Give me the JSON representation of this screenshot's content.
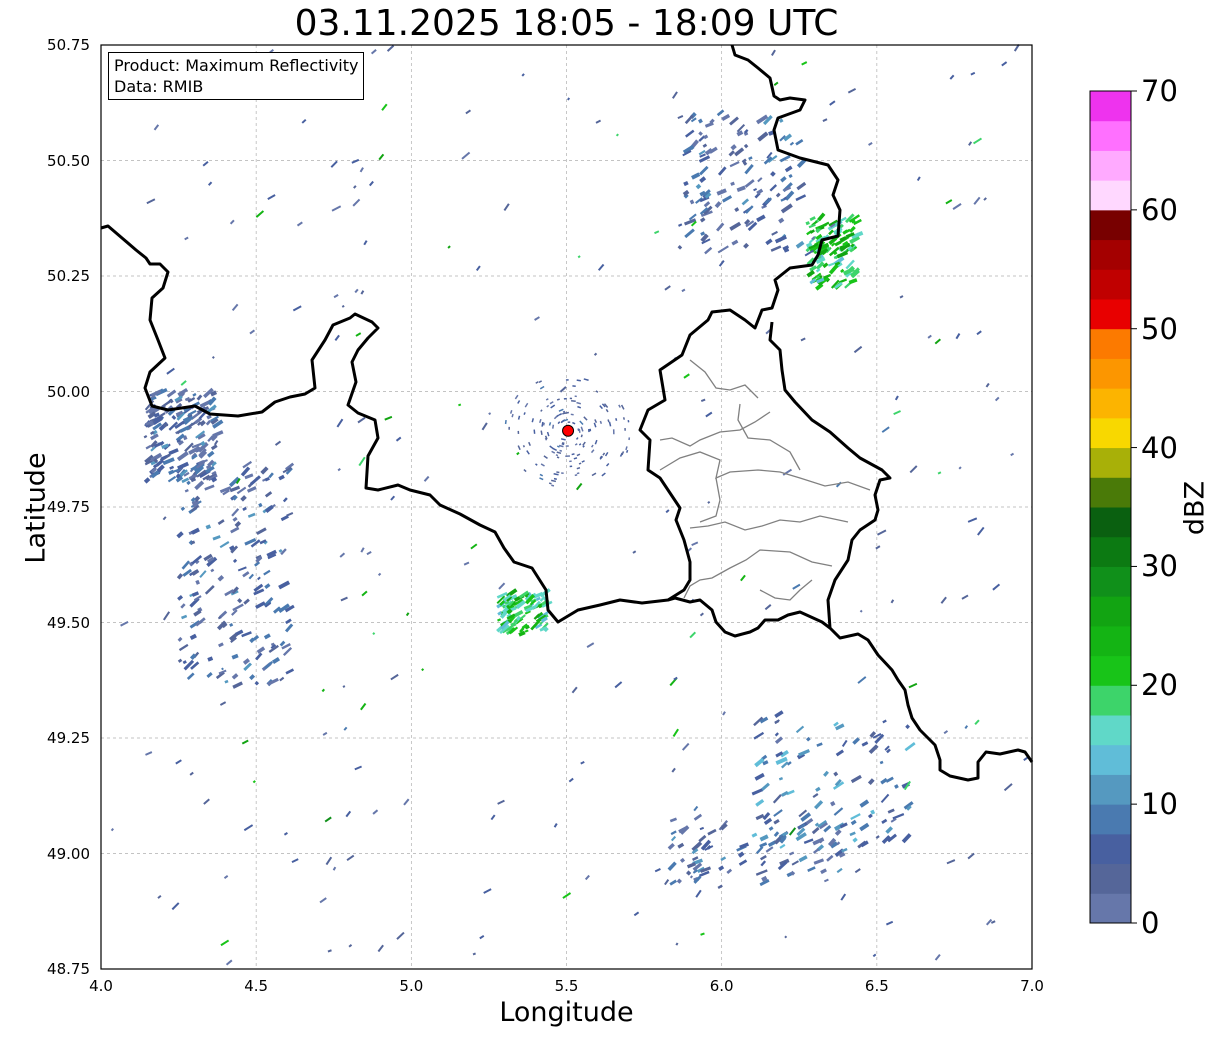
{
  "title": "03.11.2025 18:05 - 18:09 UTC",
  "infobox": {
    "product": "Product: Maximum Reflectivity",
    "data": "Data: RMIB"
  },
  "axes": {
    "xlabel": "Longitude",
    "ylabel": "Latitude",
    "xlim": [
      4.0,
      7.0
    ],
    "ylim": [
      48.75,
      50.75
    ],
    "xticks": [
      "4.0",
      "4.5",
      "5.0",
      "5.5",
      "6.0",
      "6.5",
      "7.0"
    ],
    "yticks": [
      "50.75",
      "50.50",
      "50.25",
      "50.00",
      "49.75",
      "49.50",
      "49.25",
      "49.00",
      "48.75"
    ],
    "grid": true
  },
  "colorbar": {
    "label": "dBZ",
    "ticks": [
      "70",
      "60",
      "50",
      "40",
      "30",
      "20",
      "10",
      "0"
    ],
    "range": [
      0,
      70
    ],
    "colors": [
      "#6677aa",
      "#556699",
      "#4860a0",
      "#4a7ab0",
      "#5599c0",
      "#60bdd8",
      "#60d8c8",
      "#3dd46a",
      "#18c418",
      "#14b414",
      "#12a412",
      "#10901a",
      "#0c7a12",
      "#0a6010",
      "#4a7a08",
      "#a8b008",
      "#f8d800",
      "#fcb400",
      "#fc9600",
      "#fc7a00",
      "#e80000",
      "#c00000",
      "#a40000",
      "#780000",
      "#ffd8ff",
      "#ffaaff",
      "#ff70ff",
      "#ee33ee"
    ]
  },
  "radar_site": {
    "lon": 5.505,
    "lat": 49.915,
    "color": "#ff0000"
  },
  "chart_data": {
    "type": "map",
    "product": "Maximum Reflectivity",
    "source": "RMIB",
    "time": "03.11.2025 18:05 - 18:09 UTC",
    "echo_clusters": [
      {
        "lon": 4.25,
        "lat": 49.9,
        "dbz": 5
      },
      {
        "lon": 4.42,
        "lat": 49.6,
        "dbz": 5
      },
      {
        "lon": 6.35,
        "lat": 49.15,
        "dbz": 8
      },
      {
        "lon": 6.1,
        "lat": 49.0,
        "dbz": 6
      },
      {
        "lon": 6.05,
        "lat": 50.45,
        "dbz": 5
      },
      {
        "lon": 6.35,
        "lat": 50.3,
        "dbz": 20
      },
      {
        "lon": 5.35,
        "lat": 49.52,
        "dbz": 20
      }
    ]
  }
}
